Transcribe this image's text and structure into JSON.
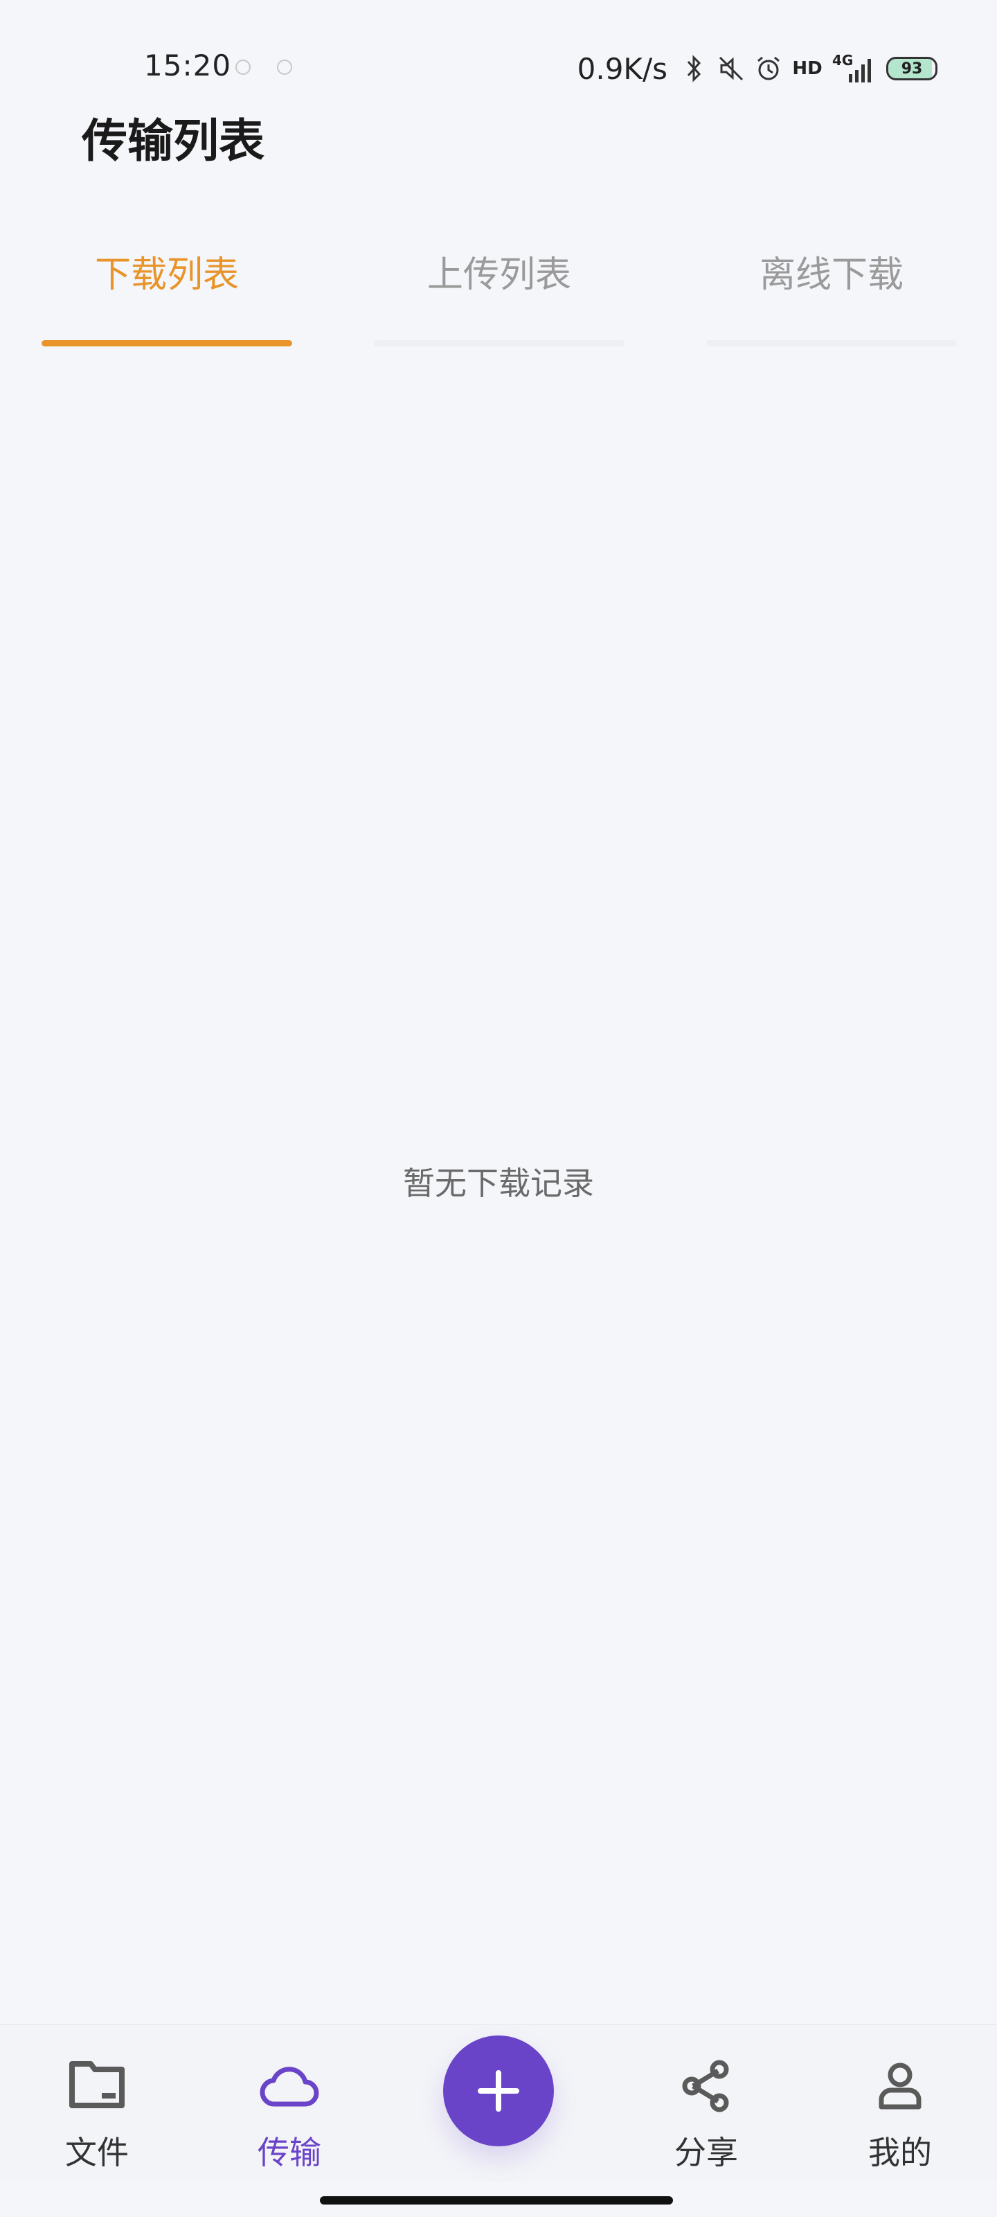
{
  "status_bar": {
    "time": "15:20",
    "network_speed": "0.9K/s",
    "network_type": "4G",
    "hd_label": "HD",
    "battery_level": "93",
    "battery_fraction": 0.93,
    "icons": [
      "bluetooth-icon",
      "mute-icon",
      "alarm-icon",
      "hd-icon",
      "signal-icon",
      "battery-icon"
    ]
  },
  "header": {
    "title": "传输列表"
  },
  "tabs": [
    {
      "label": "下载列表",
      "active": true
    },
    {
      "label": "上传列表",
      "active": false
    },
    {
      "label": "离线下载",
      "active": false
    }
  ],
  "empty_state": {
    "text": "暂无下载记录"
  },
  "bottom_nav": {
    "items": [
      {
        "label": "文件",
        "icon": "folder-icon",
        "active": false
      },
      {
        "label": "传输",
        "icon": "cloud-icon",
        "active": true
      },
      {
        "label": "分享",
        "icon": "share-icon",
        "active": false
      },
      {
        "label": "我的",
        "icon": "user-icon",
        "active": false
      }
    ],
    "fab_icon": "plus-icon"
  },
  "colors": {
    "accent_tab": "#e8942a",
    "accent_nav": "#6a44c8",
    "background": "#f5f6fa",
    "inactive_text": "#9a9a9a"
  }
}
